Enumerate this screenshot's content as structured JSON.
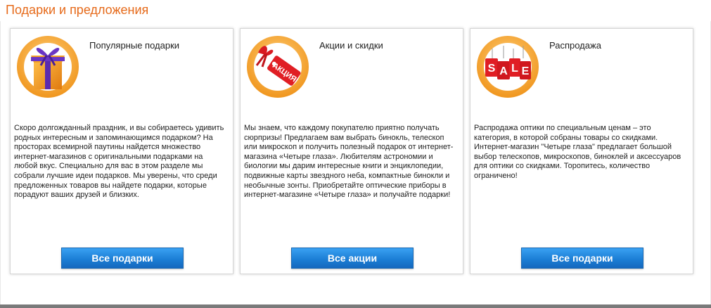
{
  "section": {
    "title": "Подарки и предложения"
  },
  "colors": {
    "accent": "#e66a1a",
    "button": "#1c7fd6",
    "ring": "#f4a73a"
  },
  "cards": [
    {
      "icon": "gift-box-icon",
      "title": "Популярные подарки",
      "text": "Скоро долгожданный праздник, и вы собираетесь удивить родных интересным и запоминающимся подарком? На просторах всемирной паутины найдется множество интернет-магазинов с оригинальными подарками на любой вкус. Специально для вас в этом разделе мы собрали лучшие идеи подарков. Мы уверены, что среди предложенных товаров вы найдете подарки, которые порадуют ваших друзей и близких.",
      "button": "Все подарки"
    },
    {
      "icon": "promo-tag-icon",
      "title": "Акции и скидки",
      "tag_text": "АКЦИЯ",
      "text": "Мы знаем, что каждому покупателю приятно получать сюрпризы! Предлагаем вам выбрать бинокль, телескоп или микроскоп и получить полезный подарок от интернет-магазина «Четыре глаза». Любителям астрономии и биологии мы дарим интересные книги и энциклопедии, подвижные карты звездного неба, компактные бинокли и необычные зонты. Приобретайте оптические приборы в интернет-магазине «Четыре глаза» и получайте подарки!",
      "button": "Все акции"
    },
    {
      "icon": "sale-tags-icon",
      "title": "Распродажа",
      "tag_letters": [
        "S",
        "A",
        "L",
        "E"
      ],
      "text": "Распродажа оптики по специальным ценам – это категория, в которой собраны товары со скидками. Интернет-магазин \"Четыре глаза\" предлагает большой выбор телескопов, микроскопов, биноклей и аксессуаров для оптики со скидками. Торопитесь, количество ограничено!",
      "button": "Все подарки"
    }
  ]
}
